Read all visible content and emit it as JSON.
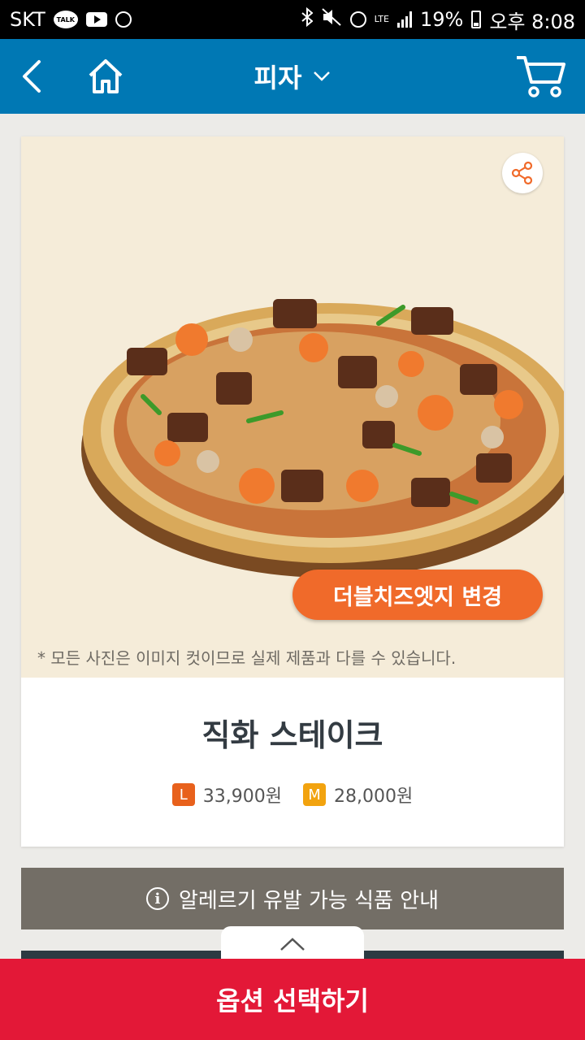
{
  "status_bar": {
    "carrier": "SKT",
    "talk_label": "TALK",
    "network": "LTE",
    "battery": "19%",
    "time": "오후 8:08"
  },
  "header": {
    "title": "피자",
    "icons": [
      "back-arrow-icon",
      "home-icon",
      "chevron-down-icon",
      "cart-icon"
    ]
  },
  "product": {
    "edge_change_label": "더블치즈엣지 변경",
    "disclaimer": "* 모든 사진은 이미지 컷이므로 실제 제품과 다를 수 있습니다.",
    "name": "직화 스테이크",
    "prices": [
      {
        "size": "L",
        "price": "33,900원",
        "color": "#e8611c"
      },
      {
        "size": "M",
        "price": "28,000원",
        "color": "#f2a30f"
      }
    ]
  },
  "allergy": {
    "label": "알레르기 유발 가능 식품 안내",
    "icon": "i"
  },
  "bottom": {
    "option_label": "옵션 선택하기"
  },
  "colors": {
    "header": "#0078b4",
    "edge_button": "#f06a2a",
    "option_button": "#e31837",
    "allergy_button": "#736e66"
  }
}
